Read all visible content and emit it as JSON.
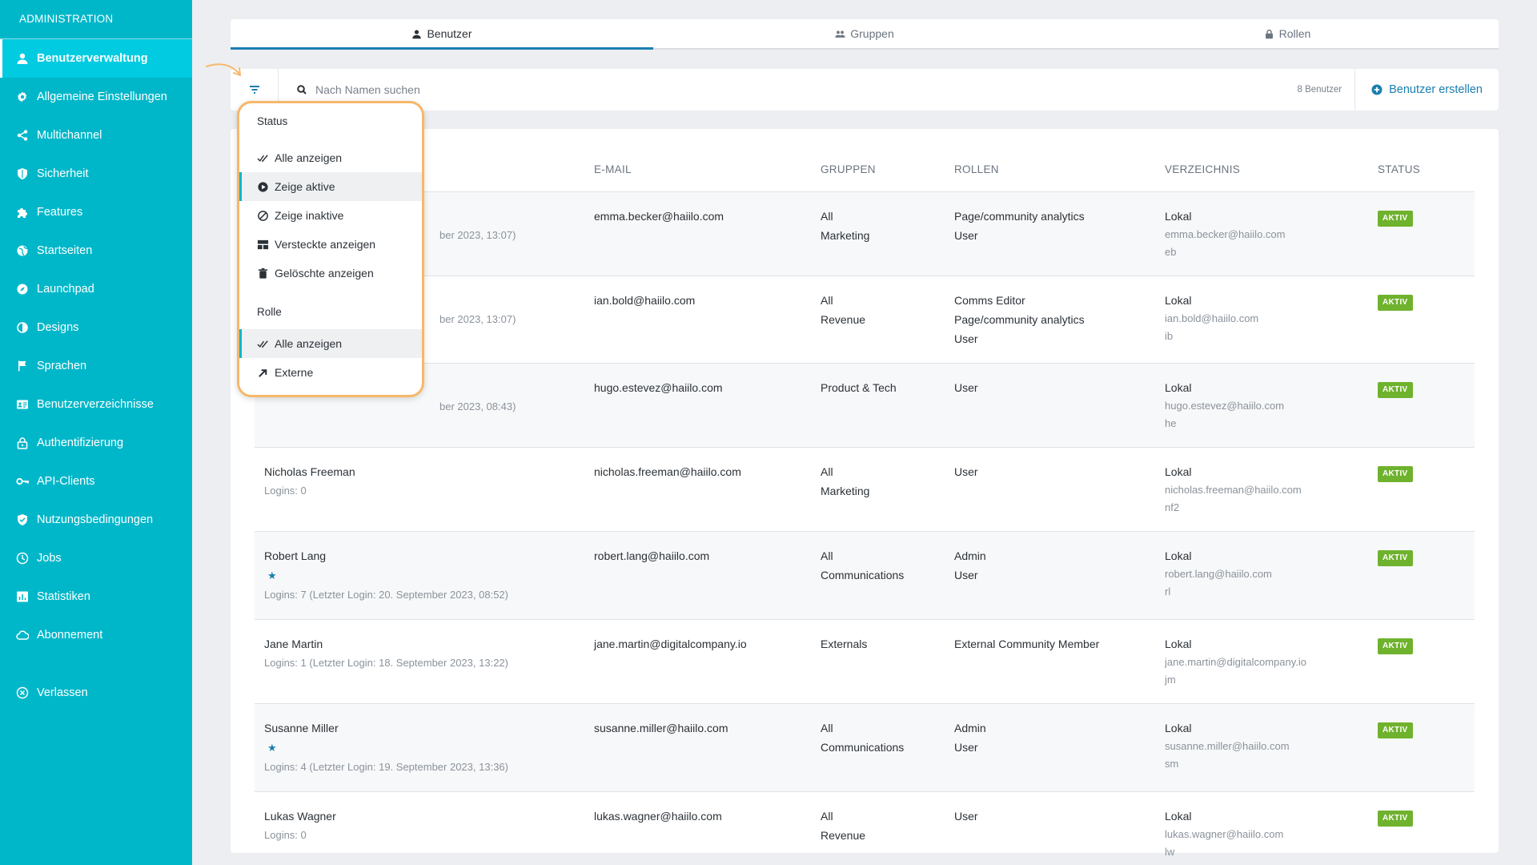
{
  "sidebar": {
    "header": "ADMINISTRATION",
    "items": [
      {
        "label": "Benutzerverwaltung",
        "icon": "user-icon",
        "active": true
      },
      {
        "label": "Allgemeine Einstellungen",
        "icon": "gear-icon"
      },
      {
        "label": "Multichannel",
        "icon": "share-icon"
      },
      {
        "label": "Sicherheit",
        "icon": "shield-icon"
      },
      {
        "label": "Features",
        "icon": "puzzle-icon"
      },
      {
        "label": "Startseiten",
        "icon": "globe-icon"
      },
      {
        "label": "Launchpad",
        "icon": "compass-icon"
      },
      {
        "label": "Designs",
        "icon": "contrast-icon"
      },
      {
        "label": "Sprachen",
        "icon": "flag-icon"
      },
      {
        "label": "Benutzerverzeichnisse",
        "icon": "directory-icon"
      },
      {
        "label": "Authentifizierung",
        "icon": "lock-icon"
      },
      {
        "label": "API-Clients",
        "icon": "key-icon"
      },
      {
        "label": "Nutzungsbedingungen",
        "icon": "shield-check-icon"
      },
      {
        "label": "Jobs",
        "icon": "clock-icon"
      },
      {
        "label": "Statistiken",
        "icon": "chart-icon"
      },
      {
        "label": "Abonnement",
        "icon": "cloud-icon"
      }
    ],
    "leave": {
      "label": "Verlassen",
      "icon": "close-circle-icon"
    }
  },
  "tabs": [
    {
      "label": "Benutzer",
      "icon": "user-icon",
      "active": true
    },
    {
      "label": "Gruppen",
      "icon": "group-icon"
    },
    {
      "label": "Rollen",
      "icon": "lock-icon"
    }
  ],
  "toolbar": {
    "search_placeholder": "Nach Namen suchen",
    "user_count": "8 Benutzer",
    "create_label": "Benutzer erstellen"
  },
  "filter_menu": {
    "status_title": "Status",
    "status_items": [
      {
        "label": "Alle anzeigen",
        "icon": "check-double-icon"
      },
      {
        "label": "Zeige aktive",
        "icon": "play-circle-icon",
        "selected": true
      },
      {
        "label": "Zeige inaktive",
        "icon": "block-icon"
      },
      {
        "label": "Versteckte anzeigen",
        "icon": "grid-icon"
      },
      {
        "label": "Gelöschte anzeigen",
        "icon": "trash-icon"
      }
    ],
    "role_title": "Rolle",
    "role_items": [
      {
        "label": "Alle anzeigen",
        "icon": "check-double-icon",
        "selected": true
      },
      {
        "label": "Externe",
        "icon": "arrow-external-icon"
      }
    ]
  },
  "table": {
    "headers": [
      "",
      "E-MAIL",
      "GRUPPEN",
      "ROLLEN",
      "VERZEICHNIS",
      "STATUS"
    ],
    "rows": [
      {
        "name": "",
        "logins": "ber 2023, 13:07)",
        "star": false,
        "email": "emma.becker@haiilo.com",
        "groups": [
          "All",
          "Marketing"
        ],
        "roles": [
          "Page/community analytics",
          "User"
        ],
        "dir": "Lokal",
        "dir_email": "emma.becker@haiilo.com",
        "dir_id": "eb",
        "status": "AKTIV"
      },
      {
        "name": "",
        "logins": "ber 2023, 13:07)",
        "star": false,
        "email": "ian.bold@haiilo.com",
        "groups": [
          "All",
          "Revenue"
        ],
        "roles": [
          "Comms Editor",
          "Page/community analytics",
          "User"
        ],
        "dir": "Lokal",
        "dir_email": "ian.bold@haiilo.com",
        "dir_id": "ib",
        "status": "AKTIV"
      },
      {
        "name": "",
        "logins": "ber 2023, 08:43)",
        "star": false,
        "email": "hugo.estevez@haiilo.com",
        "groups": [
          "Product & Tech"
        ],
        "roles": [
          "User"
        ],
        "dir": "Lokal",
        "dir_email": "hugo.estevez@haiilo.com",
        "dir_id": "he",
        "status": "AKTIV"
      },
      {
        "name": "Nicholas Freeman",
        "logins": "Logins: 0",
        "star": false,
        "email": "nicholas.freeman@haiilo.com",
        "groups": [
          "All",
          "Marketing"
        ],
        "roles": [
          "User"
        ],
        "dir": "Lokal",
        "dir_email": "nicholas.freeman@haiilo.com",
        "dir_id": "nf2",
        "status": "AKTIV"
      },
      {
        "name": "Robert Lang",
        "logins": "Logins: 7 (Letzter Login: 20. September 2023, 08:52)",
        "star": true,
        "email": "robert.lang@haiilo.com",
        "groups": [
          "All",
          "Communications"
        ],
        "roles": [
          "Admin",
          "User"
        ],
        "dir": "Lokal",
        "dir_email": "robert.lang@haiilo.com",
        "dir_id": "rl",
        "status": "AKTIV"
      },
      {
        "name": "Jane Martin",
        "logins": "Logins: 1 (Letzter Login: 18. September 2023, 13:22)",
        "star": false,
        "email": "jane.martin@digitalcompany.io",
        "groups": [
          "Externals"
        ],
        "roles": [
          "External Community Member"
        ],
        "dir": "Lokal",
        "dir_email": "jane.martin@digitalcompany.io",
        "dir_id": "jm",
        "status": "AKTIV"
      },
      {
        "name": "Susanne Miller",
        "logins": "Logins: 4 (Letzter Login: 19. September 2023, 13:36)",
        "star": true,
        "email": "susanne.miller@haiilo.com",
        "groups": [
          "All",
          "Communications"
        ],
        "roles": [
          "Admin",
          "User"
        ],
        "dir": "Lokal",
        "dir_email": "susanne.miller@haiilo.com",
        "dir_id": "sm",
        "status": "AKTIV"
      },
      {
        "name": "Lukas Wagner",
        "logins": "Logins: 0",
        "star": false,
        "email": "lukas.wagner@haiilo.com",
        "groups": [
          "All",
          "Revenue"
        ],
        "roles": [
          "User"
        ],
        "dir": "Lokal",
        "dir_email": "lukas.wagner@haiilo.com",
        "dir_id": "lw",
        "status": "AKTIV"
      }
    ]
  },
  "colors": {
    "sidebar": "#00b7c9",
    "accent": "#1a7eb0",
    "badge": "#6fb22d",
    "highlight": "#f6b86a"
  }
}
